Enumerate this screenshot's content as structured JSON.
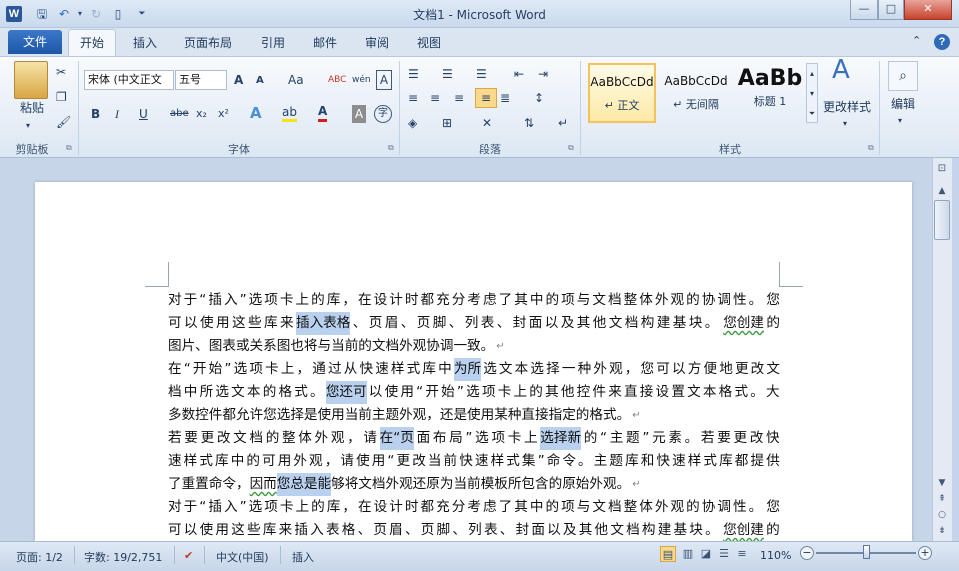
{
  "window": {
    "app_icon": "W",
    "title": "文档1  -  Microsoft Word",
    "controls": {
      "minimize": "—",
      "maximize": "□",
      "close": "✕"
    }
  },
  "qat": {
    "save_icon": "save-icon",
    "undo_icon": "undo-icon",
    "redo_icon": "redo-icon",
    "new_icon": "new-doc-icon"
  },
  "tabs": {
    "file": "文件",
    "items": [
      "开始",
      "插入",
      "页面布局",
      "引用",
      "邮件",
      "审阅",
      "视图"
    ],
    "active": "开始"
  },
  "ribbon": {
    "clipboard": {
      "paste": "粘贴",
      "label": "剪贴板"
    },
    "font": {
      "font_name": "宋体 (中文正文",
      "font_size": "五号",
      "grow": "A",
      "shrink": "A",
      "case": "Aa",
      "clear_format": "ABC",
      "phonetic": "wén",
      "border_char": "A",
      "bold": "B",
      "italic": "I",
      "underline": "U",
      "strike": "abe",
      "subscript": "x₂",
      "superscript": "x²",
      "text_effect": "A",
      "highlight": "ab",
      "font_color": "A",
      "char_shading": "A",
      "enclose": "字",
      "label": "字体"
    },
    "paragraph": {
      "label": "段落"
    },
    "styles": {
      "items": [
        {
          "sample": "AaBbCcDd",
          "name": "↵ 正文"
        },
        {
          "sample": "AaBbCcDd",
          "name": "↵ 无间隔"
        },
        {
          "sample": "AaBb",
          "name": "标题 1"
        }
      ],
      "change_styles": "更改样式",
      "label": "样式"
    },
    "editing": {
      "label": "编辑"
    }
  },
  "document": {
    "lines": [
      [
        "对于“插入”选项卡上的库，在设计时都充分考虑了其中的项与文档整体外观的协调性。 您"
      ],
      [
        "可以使用这些库来",
        {
          "hl": "插入表格"
        },
        "、页眉、页脚、列表、封面以及其他文档构建基块。 ",
        {
          "ul": "您创建"
        },
        "的"
      ],
      [
        "图片、图表或关系图也将与当前的文档外观协调一致。",
        {
          "p": "↵"
        }
      ],
      [
        "在“开始”选项卡上，通过从快速样式库中",
        {
          "hl": "为所"
        },
        "选文本选择一种外观，您可以方便地更改文"
      ],
      [
        "档中所选文本的格式。",
        {
          "hl": "您还可"
        },
        "以使用“开始”选项卡上的其他控件来直接设置文本格式。大"
      ],
      [
        "多数控件都允许您选择是使用当前主题外观，还是使用某种直接指定的格式。",
        {
          "p": "↵"
        }
      ],
      [
        "若要更改文档的整体外观，请",
        {
          "hl": "在“页"
        },
        "面布局”选项卡上",
        {
          "hl": "选择新"
        },
        "的“主题”元素。若要更改快"
      ],
      [
        "速样式库中的可用外观，请使用“更改当前快速样式集”命令。主题库和快速样式库都提供"
      ],
      [
        "了重置命令，",
        {
          "ul": "因而"
        },
        {
          "hl": "您总是能"
        },
        "够将文档外观还原为当前模板所包含的原始外观。",
        {
          "p": "↵"
        }
      ],
      [
        "对于“插入”选项卡上的库，在设计时都充分考虑了其中的项与文档整体外观的协调性。 您"
      ],
      [
        "可以使用这些库来插入表格、页眉、页脚、列表、封面以及其他文档构建基块。 ",
        {
          "ul": "您创建"
        },
        "的"
      ]
    ]
  },
  "status": {
    "page": "页面: 1/2",
    "words": "字数: 19/2,751",
    "language": "中文(中国)",
    "insert_mode": "插入",
    "zoom": "110%",
    "zoom_level_percent": 110
  },
  "colors": {
    "file_tab": "#1e56a8",
    "highlight": "#b9d1ee",
    "active_style": "#f3c25b"
  }
}
